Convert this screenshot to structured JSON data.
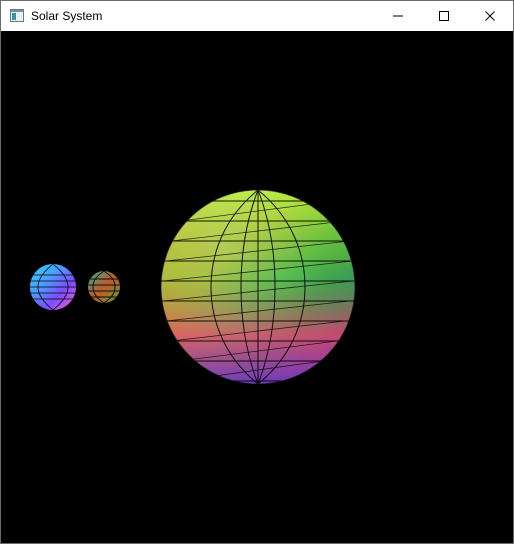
{
  "window": {
    "title": "Solar System",
    "controls": {
      "minimize_icon": "minimize-icon",
      "maximize_icon": "maximize-icon",
      "close_icon": "close-icon"
    }
  },
  "scene": {
    "background": "#000000",
    "bodies": [
      {
        "name": "planet-large",
        "gradient": [
          "#c7e33a",
          "#2fd36a",
          "#ff3b68",
          "#6b2cc8"
        ]
      },
      {
        "name": "planet-small-left",
        "gradient": [
          "#4aa0ff",
          "#7b4dff",
          "#ff64c8"
        ]
      },
      {
        "name": "planet-small-right",
        "gradient": [
          "#3de3b4",
          "#ff7a3a",
          "#7ad33a"
        ]
      }
    ],
    "wireframe_color": "#000000"
  }
}
